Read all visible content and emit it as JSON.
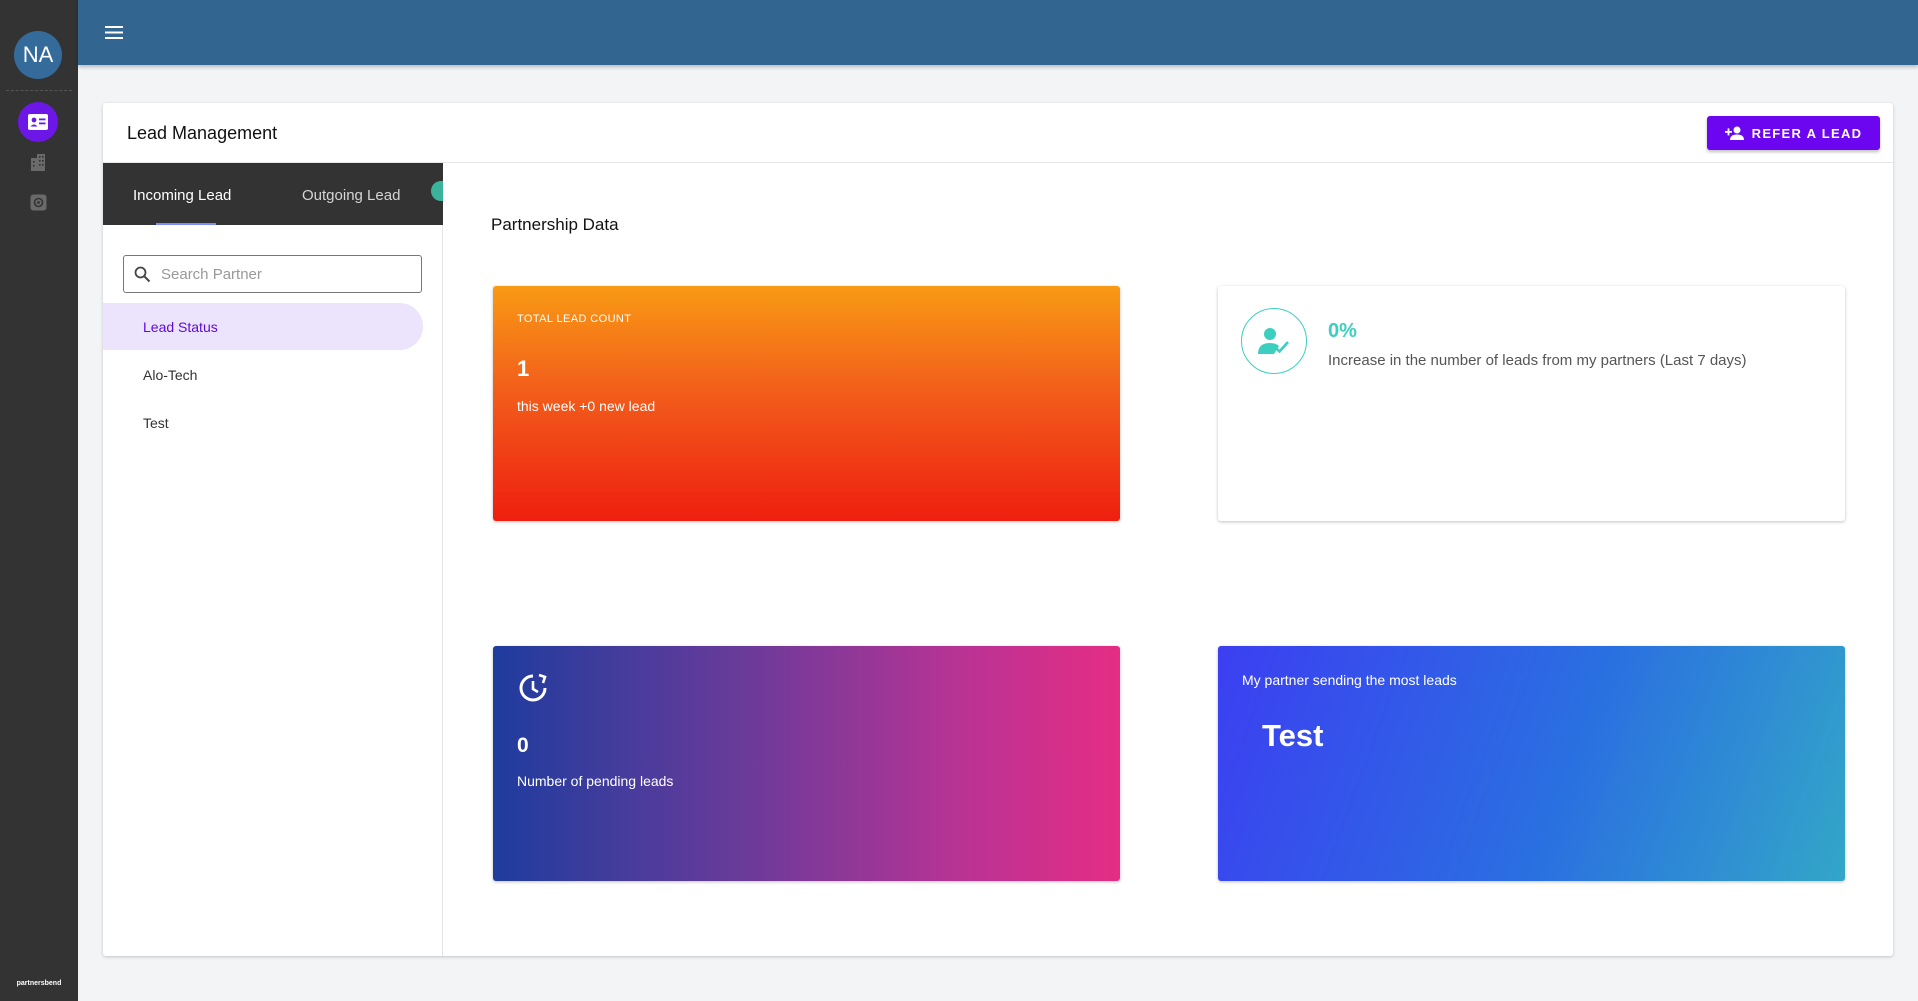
{
  "rail": {
    "avatar_initials": "NA",
    "brand": "partnersbend",
    "nav": [
      {
        "name": "lead-management",
        "icon": "contact-card-icon",
        "active": true
      },
      {
        "name": "companies",
        "icon": "buildings-icon",
        "active": false
      },
      {
        "name": "integrations",
        "icon": "settings-box-icon",
        "active": false
      }
    ]
  },
  "topbar": {
    "menu_icon": "menu-icon"
  },
  "header": {
    "title": "Lead Management",
    "refer_button": "REFER A LEAD"
  },
  "tabs": {
    "incoming": "Incoming Lead",
    "outgoing": "Outgoing Lead"
  },
  "search": {
    "placeholder": "Search Partner",
    "value": ""
  },
  "partners": [
    {
      "label": "Lead Status",
      "active": true
    },
    {
      "label": "Alo-Tech",
      "active": false
    },
    {
      "label": "Test",
      "active": false
    }
  ],
  "main": {
    "section_title": "Partnership Data",
    "total": {
      "label": "TOTAL LEAD COUNT",
      "value": "1",
      "sub": "this week +0 new lead"
    },
    "increase": {
      "value": "0%",
      "desc": "Increase in the number of leads from my partners (Last 7 days)"
    },
    "pending": {
      "value": "0",
      "sub": "Number of pending leads"
    },
    "top_partner": {
      "label": "My partner sending the most leads",
      "name": "Test"
    }
  },
  "colors": {
    "accent": "#6d06f0",
    "topbar": "#326690",
    "rail": "#333333",
    "teal": "#3ccfc0"
  }
}
